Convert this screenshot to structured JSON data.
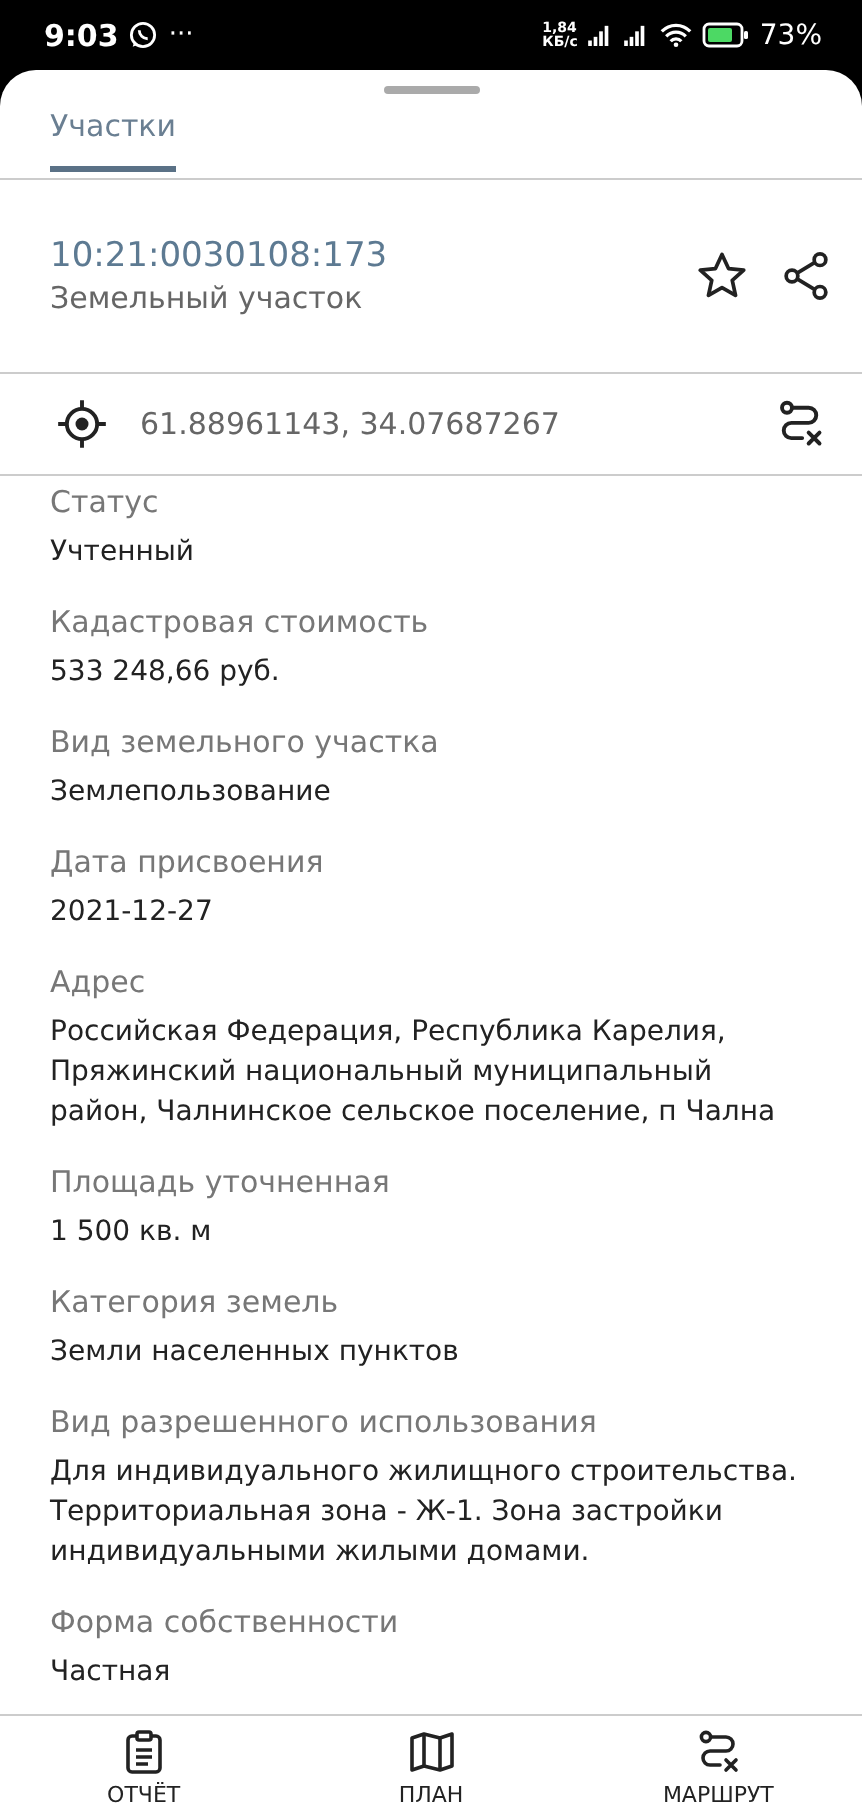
{
  "status_bar": {
    "time": "9:03",
    "more": "···",
    "speed": "1,84\nКБ/с",
    "battery": "73%"
  },
  "tabs": [
    {
      "label": "Участки",
      "selected": true
    }
  ],
  "parcel": {
    "number": "10:21:0030108:173",
    "type": "Земельный участок"
  },
  "coordinates": "61.88961143, 34.07687267",
  "fields": [
    {
      "label": "Статус",
      "value": "Учтенный"
    },
    {
      "label": "Кадастровая стоимость",
      "value": "533 248,66 руб."
    },
    {
      "label": "Вид земельного участка",
      "value": "Землепользование"
    },
    {
      "label": "Дата присвоения",
      "value": "2021-12-27"
    },
    {
      "label": "Адрес",
      "value": "Российская Федерация, Республика Карелия, Пряжинский национальный муниципальный район, Чалнинское сельское поселение, п Чална"
    },
    {
      "label": "Площадь уточненная",
      "value": "1 500 кв. м"
    },
    {
      "label": "Категория земель",
      "value": "Земли населенных пунктов"
    },
    {
      "label": "Вид разрешенного использования",
      "value": "Для индивидуального жилищного строительства. Территориальная зона - Ж-1. Зона застройки индивидуальными жилыми домами."
    },
    {
      "label": "Форма собственности",
      "value": "Частная"
    }
  ],
  "bottom_nav": [
    {
      "label": "ОТЧЁТ",
      "kind": "report"
    },
    {
      "label": "ПЛАН",
      "kind": "map"
    },
    {
      "label": "МАРШРУТ",
      "kind": "route"
    }
  ]
}
